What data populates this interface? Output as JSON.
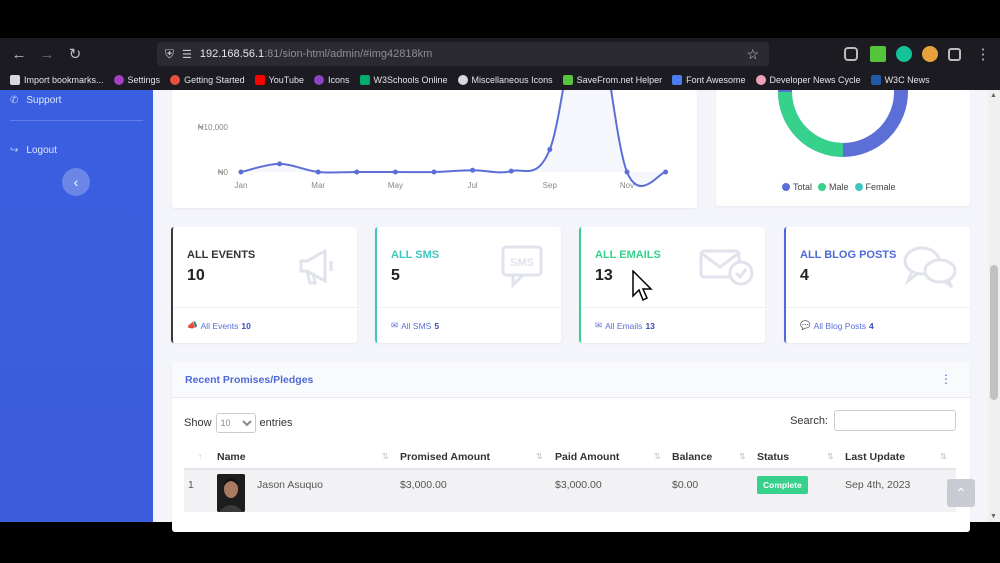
{
  "browser": {
    "url_host": "192.168.56.1",
    "url_path": ":81/sion-html/admin/#img42818km",
    "bookmarks": [
      {
        "label": "Import bookmarks...",
        "color": "#d8d8de"
      },
      {
        "label": "Settings",
        "color": "#a33fc4"
      },
      {
        "label": "Getting Started",
        "color": "#e5533d"
      },
      {
        "label": "YouTube",
        "color": "#ff0000"
      },
      {
        "label": "Icons",
        "color": "#8d44c4"
      },
      {
        "label": "W3Schools Online",
        "color": "#04aa6d"
      },
      {
        "label": "Miscellaneous Icons",
        "color": "#d8d8de"
      },
      {
        "label": "SaveFrom.net Helper",
        "color": "#56c43a"
      },
      {
        "label": "Font Awesome",
        "color": "#4d7cf0"
      },
      {
        "label": "Developer News Cycle",
        "color": "#f0a0b8"
      },
      {
        "label": "W3C News",
        "color": "#1e5aa8"
      }
    ]
  },
  "sidebar": {
    "items": [
      {
        "label": "Support",
        "icon": "phone-icon"
      },
      {
        "label": "Logout",
        "icon": "logout-icon"
      }
    ]
  },
  "line_chart": {
    "y_ticks": [
      "₦10,000",
      "₦0"
    ],
    "x_ticks": [
      "Jan",
      "Mar",
      "May",
      "Jul",
      "Sep",
      "Nov"
    ],
    "values": [
      0,
      1800,
      0,
      0,
      0,
      0,
      400,
      200,
      5000,
      42000,
      0,
      0
    ],
    "color": "#5b6fd6"
  },
  "donut_chart": {
    "legend": [
      {
        "label": "Total",
        "color": "#5b6fd6"
      },
      {
        "label": "Male",
        "color": "#36d18a"
      },
      {
        "label": "Female",
        "color": "#3cc8c0"
      }
    ],
    "colors": {
      "male": "#36d18a",
      "total": "#5b6fd6"
    }
  },
  "stats": [
    {
      "title": "All Events",
      "value": "10",
      "foot_label": "All Events",
      "foot_value": "10",
      "color": "#333333",
      "border": "#3a3a3a",
      "icon": "megaphone-icon"
    },
    {
      "title": "All SMS",
      "value": "5",
      "foot_label": "All SMS",
      "foot_value": "5",
      "color": "#3cc8c0",
      "border": "#3cc8c0",
      "icon": "sms-icon"
    },
    {
      "title": "All Emails",
      "value": "13",
      "foot_label": "All Emails",
      "foot_value": "13",
      "color": "#36d18a",
      "border": "#36d18a",
      "icon": "email-icon"
    },
    {
      "title": "All Blog Posts",
      "value": "4",
      "foot_label": "All Blog Posts",
      "foot_value": "4",
      "color": "#4e6ad8",
      "border": "#4e6ad8",
      "icon": "chat-icon"
    }
  ],
  "table": {
    "title": "Recent Promises/Pledges",
    "show_label": "Show",
    "entries_value": "10",
    "entries_label": "entries",
    "search_label": "Search:",
    "columns": [
      "Name",
      "Promised Amount",
      "Paid Amount",
      "Balance",
      "Status",
      "Last Update"
    ],
    "rows": [
      {
        "index": "1",
        "name": "Jason Asuquo",
        "promised": "$3,000.00",
        "paid": "$3,000.00",
        "balance": "$0.00",
        "status": "Complete",
        "updated": "Sep 4th, 2023"
      }
    ]
  }
}
